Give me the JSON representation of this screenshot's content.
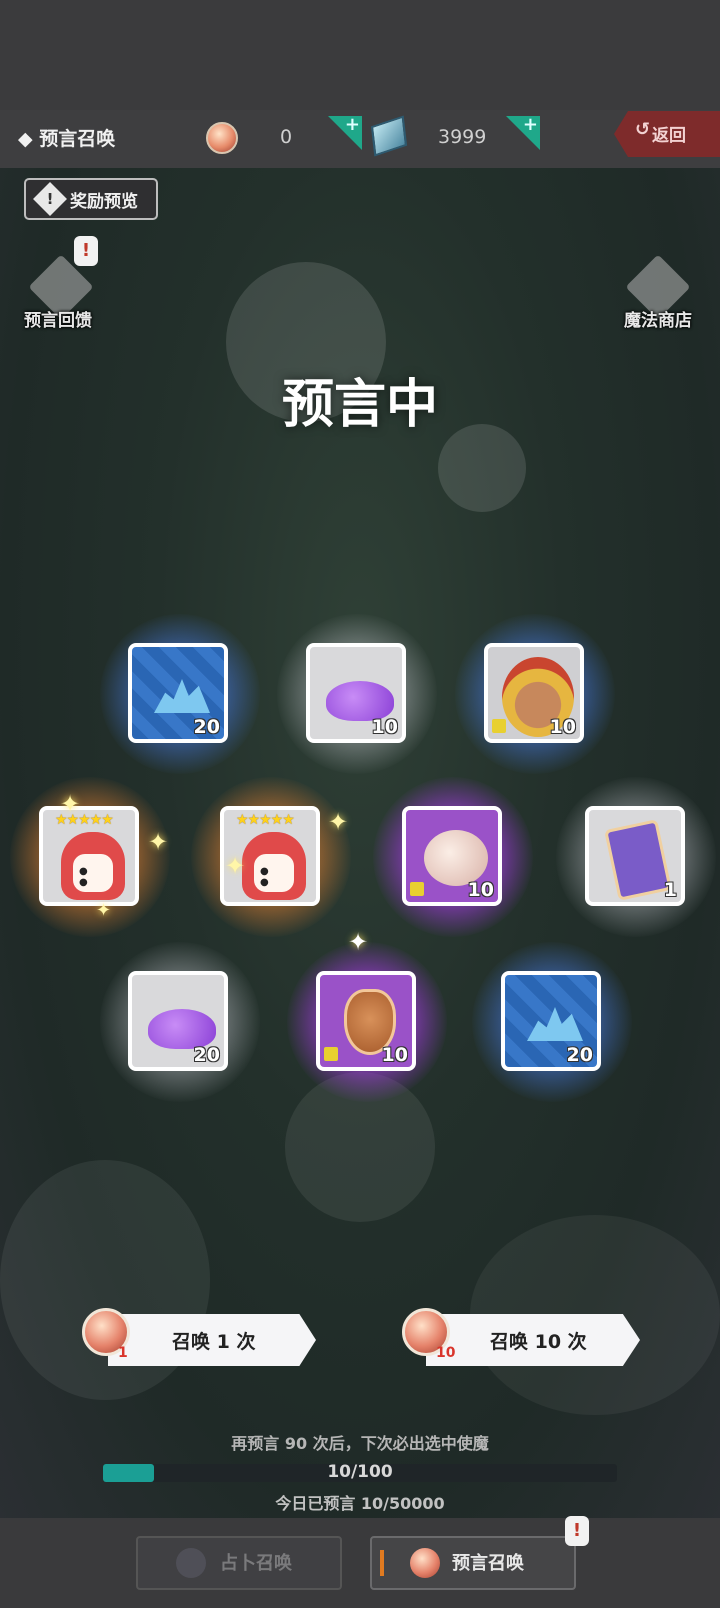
{
  "header": {
    "title": "预言召唤",
    "title_prefix": "◆",
    "orb_count": "0",
    "gem_count": "3999",
    "plus": "+",
    "back_label": "返回",
    "back_arrow": "↺"
  },
  "side": {
    "reward_preview": "奖励预览",
    "reward_icon": "!",
    "feedback_label": "预言回馈",
    "alert": "!",
    "shop_label": "魔法商店"
  },
  "status_title": "预言中",
  "items": [
    {
      "kind": "crystal",
      "rarity": "blue",
      "count": "20"
    },
    {
      "kind": "dust",
      "rarity": "white",
      "count": "10"
    },
    {
      "kind": "hero",
      "rarity": "blue",
      "count": "10"
    },
    {
      "kind": "character",
      "rarity": "orange",
      "stars": "★★★★★"
    },
    {
      "kind": "character",
      "rarity": "orange",
      "stars": "★★★★★"
    },
    {
      "kind": "egg",
      "rarity": "purple",
      "count": "10"
    },
    {
      "kind": "card",
      "rarity": "white",
      "count": "1"
    },
    {
      "kind": "dust",
      "rarity": "white",
      "count": "20"
    },
    {
      "kind": "shield",
      "rarity": "purple",
      "count": "10"
    },
    {
      "kind": "crystal",
      "rarity": "blue",
      "count": "20"
    }
  ],
  "summon": {
    "single_label": "召唤 1 次",
    "single_cost": "1",
    "ten_label": "召唤 10 次",
    "ten_cost": "10"
  },
  "progress": {
    "hint": "再预言 90 次后，下次必出选中使魔",
    "text": "10/100",
    "fraction": 0.1,
    "today": "今日已预言 10/50000"
  },
  "nav": {
    "tab1": "占卜召唤",
    "tab2": "预言召唤",
    "alert": "!"
  },
  "colors": {
    "accent_teal": "#1b9f95",
    "back_red": "#7e2b2b",
    "purple_glow": "#b050e8",
    "blue_glow": "#5a8ee0",
    "orange_glow": "#f0a050"
  }
}
